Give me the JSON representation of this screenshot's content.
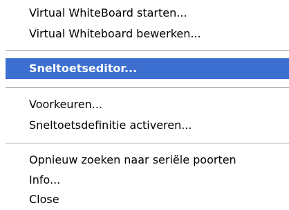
{
  "menu": {
    "groups": [
      {
        "items": [
          {
            "label": "Virtual WhiteBoard starten..."
          },
          {
            "label": "Virtual Whiteboard bewerken..."
          }
        ]
      },
      {
        "items": [
          {
            "label": "Sneltoetseditor...",
            "selected": true
          }
        ]
      },
      {
        "items": [
          {
            "label": "Voorkeuren..."
          },
          {
            "label": "Sneltoetsdefinitie activeren..."
          }
        ]
      },
      {
        "items": [
          {
            "label": "Opnieuw zoeken naar seriële poorten"
          },
          {
            "label": "Info..."
          },
          {
            "label": "Close"
          }
        ]
      }
    ]
  },
  "colors": {
    "highlight": "#3d6fd0",
    "highlight_text": "#ffffff",
    "separator": "#a9a9a9",
    "background": "#ffffff"
  }
}
